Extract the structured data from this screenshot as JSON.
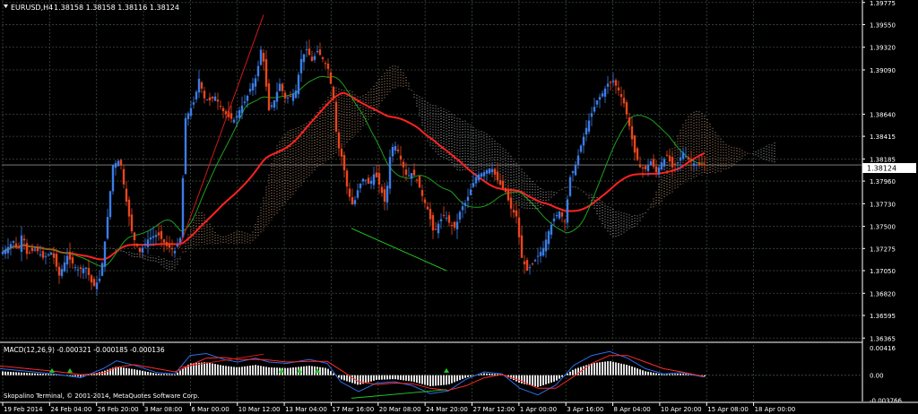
{
  "header": {
    "symbol_label": "EURUSD,H4",
    "ohlc": "1.38158 1.38158 1.38116 1.38124",
    "dropdown_icon": "triangle-down-icon"
  },
  "footer": {
    "copyright": "Skopalino Terminal, © 2001-2014, MetaQuotes Software Corp."
  },
  "colors": {
    "background": "#000000",
    "grid": "#3a4a3a",
    "axis_text": "#ffffff",
    "bull": "#3b7de8",
    "bear": "#e8461f",
    "ma_red": "#ff2222",
    "ma_green": "#1fa01f",
    "kumo_up": "#f0b890",
    "kumo_down": "#d8d8d8",
    "trend_red": "#cc1a1a",
    "trend_green": "#22c822",
    "macd_hist": "#e0e0e0",
    "macd_main": "#2b6ee8",
    "macd_signal": "#ff2a2a",
    "price_line": "#888888"
  },
  "chart_data": [
    {
      "type": "candlestick",
      "title": "EURUSD,H4",
      "y_ticks": [
        "1.39775",
        "1.39550",
        "1.39320",
        "1.39090",
        "1.38640",
        "1.38415",
        "1.38185",
        "1.37960",
        "1.37730",
        "1.37500",
        "1.37275",
        "1.37050",
        "1.36820",
        "1.36595",
        "1.36365"
      ],
      "ylim": [
        1.3634,
        1.398
      ],
      "current_price": "1.38124",
      "x_ticks": [
        "19 Feb 2014",
        "24 Feb 04:00",
        "26 Feb 20:00",
        "3 Mar 08:00",
        "6 Mar 00:00",
        "10 Mar 12:00",
        "13 Mar 04:00",
        "17 Mar 16:00",
        "20 Mar 08:00",
        "24 Mar 20:00",
        "27 Mar 12:00",
        "1 Apr 00:00",
        "3 Apr 16:00",
        "8 Apr 04:00",
        "10 Apr 20:00",
        "15 Apr 08:00",
        "18 Apr 00:00"
      ],
      "close_path": [
        [
          0,
          1.3722
        ],
        [
          8,
          1.3728
        ],
        [
          15,
          1.3735
        ],
        [
          20,
          1.3724
        ],
        [
          25,
          1.3745
        ],
        [
          30,
          1.3722
        ],
        [
          40,
          1.3727
        ],
        [
          48,
          1.3718
        ],
        [
          58,
          1.3724
        ],
        [
          66,
          1.37
        ],
        [
          75,
          1.372
        ],
        [
          86,
          1.3706
        ],
        [
          96,
          1.3708
        ],
        [
          104,
          1.3688
        ],
        [
          112,
          1.3698
        ],
        [
          118,
          1.3742
        ],
        [
          126,
          1.3812
        ],
        [
          134,
          1.3818
        ],
        [
          140,
          1.378
        ],
        [
          148,
          1.374
        ],
        [
          156,
          1.3724
        ],
        [
          166,
          1.3738
        ],
        [
          176,
          1.3742
        ],
        [
          186,
          1.373
        ],
        [
          195,
          1.3725
        ],
        [
          201,
          1.3738
        ],
        [
          207,
          1.386
        ],
        [
          212,
          1.3868
        ],
        [
          217,
          1.3878
        ],
        [
          222,
          1.39
        ],
        [
          228,
          1.388
        ],
        [
          234,
          1.3878
        ],
        [
          240,
          1.3882
        ],
        [
          248,
          1.3868
        ],
        [
          256,
          1.386
        ],
        [
          262,
          1.3858
        ],
        [
          268,
          1.387
        ],
        [
          274,
          1.3878
        ],
        [
          280,
          1.3892
        ],
        [
          286,
          1.3902
        ],
        [
          292,
          1.3935
        ],
        [
          296,
          1.39
        ],
        [
          300,
          1.3868
        ],
        [
          306,
          1.3878
        ],
        [
          312,
          1.3895
        ],
        [
          318,
          1.388
        ],
        [
          324,
          1.3882
        ],
        [
          330,
          1.3888
        ],
        [
          336,
          1.392
        ],
        [
          342,
          1.393
        ],
        [
          348,
          1.3918
        ],
        [
          354,
          1.3928
        ],
        [
          360,
          1.392
        ],
        [
          366,
          1.391
        ],
        [
          372,
          1.388
        ],
        [
          376,
          1.3835
        ],
        [
          382,
          1.3818
        ],
        [
          388,
          1.3785
        ],
        [
          394,
          1.377
        ],
        [
          400,
          1.379
        ],
        [
          406,
          1.38
        ],
        [
          412,
          1.3792
        ],
        [
          418,
          1.3805
        ],
        [
          424,
          1.379
        ],
        [
          430,
          1.3772
        ],
        [
          436,
          1.383
        ],
        [
          442,
          1.3832
        ],
        [
          448,
          1.3815
        ],
        [
          454,
          1.38
        ],
        [
          460,
          1.3805
        ],
        [
          466,
          1.3795
        ],
        [
          472,
          1.3778
        ],
        [
          478,
          1.3765
        ],
        [
          484,
          1.3742
        ],
        [
          490,
          1.3755
        ],
        [
          496,
          1.3762
        ],
        [
          502,
          1.3752
        ],
        [
          508,
          1.3748
        ],
        [
          514,
          1.3768
        ],
        [
          520,
          1.3775
        ],
        [
          526,
          1.379
        ],
        [
          532,
          1.3802
        ],
        [
          540,
          1.3805
        ],
        [
          548,
          1.381
        ],
        [
          556,
          1.3795
        ],
        [
          564,
          1.3785
        ],
        [
          570,
          1.3768
        ],
        [
          576,
          1.376
        ],
        [
          582,
          1.3718
        ],
        [
          588,
          1.3705
        ],
        [
          594,
          1.3712
        ],
        [
          600,
          1.372
        ],
        [
          606,
          1.3728
        ],
        [
          612,
          1.3745
        ],
        [
          618,
          1.3758
        ],
        [
          624,
          1.3765
        ],
        [
          630,
          1.3755
        ],
        [
          636,
          1.38
        ],
        [
          642,
          1.3812
        ],
        [
          648,
          1.3832
        ],
        [
          654,
          1.385
        ],
        [
          660,
          1.3865
        ],
        [
          666,
          1.3878
        ],
        [
          672,
          1.3885
        ],
        [
          678,
          1.3895
        ],
        [
          684,
          1.3898
        ],
        [
          690,
          1.3888
        ],
        [
          696,
          1.3875
        ],
        [
          702,
          1.3852
        ],
        [
          708,
          1.3825
        ],
        [
          714,
          1.381
        ],
        [
          720,
          1.3808
        ],
        [
          726,
          1.3816
        ],
        [
          732,
          1.3805
        ],
        [
          738,
          1.3815
        ],
        [
          744,
          1.3822
        ],
        [
          750,
          1.381
        ],
        [
          756,
          1.3815
        ],
        [
          762,
          1.3825
        ],
        [
          768,
          1.3818
        ],
        [
          774,
          1.3814
        ],
        [
          780,
          1.3812
        ],
        [
          786,
          1.3812
        ]
      ]
    },
    {
      "type": "line",
      "title": "MACD(12,26,9) -0.000321 -0.000185 -0.000136",
      "y_ticks": [
        "0.00416",
        "0.00",
        "-0.003766"
      ],
      "ylim": [
        -0.004,
        0.0046
      ],
      "series": [
        {
          "values": [
            [
              0,
              0.001
            ],
            [
              30,
              0.0006
            ],
            [
              60,
              0.0002
            ],
            [
              90,
              -0.0004
            ],
            [
              115,
              0.001
            ],
            [
              130,
              0.0022
            ],
            [
              150,
              0.0015
            ],
            [
              175,
              0.0004
            ],
            [
              195,
              0.0002
            ],
            [
              212,
              0.003
            ],
            [
              230,
              0.0033
            ],
            [
              250,
              0.0024
            ],
            [
              265,
              0.002
            ],
            [
              285,
              0.0026
            ],
            [
              300,
              0.002
            ],
            [
              320,
              0.0018
            ],
            [
              345,
              0.0024
            ],
            [
              365,
              0.0018
            ],
            [
              380,
              -0.001
            ],
            [
              400,
              -0.0025
            ],
            [
              420,
              -0.0012
            ],
            [
              440,
              -0.001
            ],
            [
              460,
              -0.0016
            ],
            [
              480,
              -0.0028
            ],
            [
              500,
              -0.0024
            ],
            [
              520,
              -0.0006
            ],
            [
              540,
              0.0005
            ],
            [
              560,
              0.0002
            ],
            [
              580,
              -0.002
            ],
            [
              600,
              -0.003
            ],
            [
              620,
              -0.0015
            ],
            [
              640,
              0.0015
            ],
            [
              660,
              0.003
            ],
            [
              680,
              0.0036
            ],
            [
              700,
              0.0026
            ],
            [
              720,
              0.001
            ],
            [
              740,
              0.0002
            ],
            [
              760,
              0.0004
            ],
            [
              786,
              -0.0003
            ]
          ]
        },
        {
          "values": [
            [
              0,
              0.0014
            ],
            [
              30,
              0.001
            ],
            [
              60,
              0.0006
            ],
            [
              90,
              0.0001
            ],
            [
              115,
              0.0003
            ],
            [
              130,
              0.0012
            ],
            [
              150,
              0.0016
            ],
            [
              175,
              0.001
            ],
            [
              195,
              0.0005
            ],
            [
              212,
              0.0015
            ],
            [
              230,
              0.0026
            ],
            [
              250,
              0.0027
            ],
            [
              265,
              0.0024
            ],
            [
              285,
              0.0024
            ],
            [
              300,
              0.0023
            ],
            [
              320,
              0.002
            ],
            [
              345,
              0.0021
            ],
            [
              365,
              0.0021
            ],
            [
              380,
              0.0008
            ],
            [
              400,
              -0.001
            ],
            [
              420,
              -0.0014
            ],
            [
              440,
              -0.0012
            ],
            [
              460,
              -0.0013
            ],
            [
              480,
              -0.002
            ],
            [
              500,
              -0.0023
            ],
            [
              520,
              -0.0016
            ],
            [
              540,
              -0.0004
            ],
            [
              560,
              0.0001
            ],
            [
              580,
              -0.0008
            ],
            [
              600,
              -0.002
            ],
            [
              620,
              -0.002
            ],
            [
              640,
              -0.0002
            ],
            [
              660,
              0.0018
            ],
            [
              680,
              0.003
            ],
            [
              700,
              0.003
            ],
            [
              720,
              0.002
            ],
            [
              740,
              0.001
            ],
            [
              760,
              0.0005
            ],
            [
              786,
              -0.0002
            ]
          ]
        }
      ]
    }
  ]
}
